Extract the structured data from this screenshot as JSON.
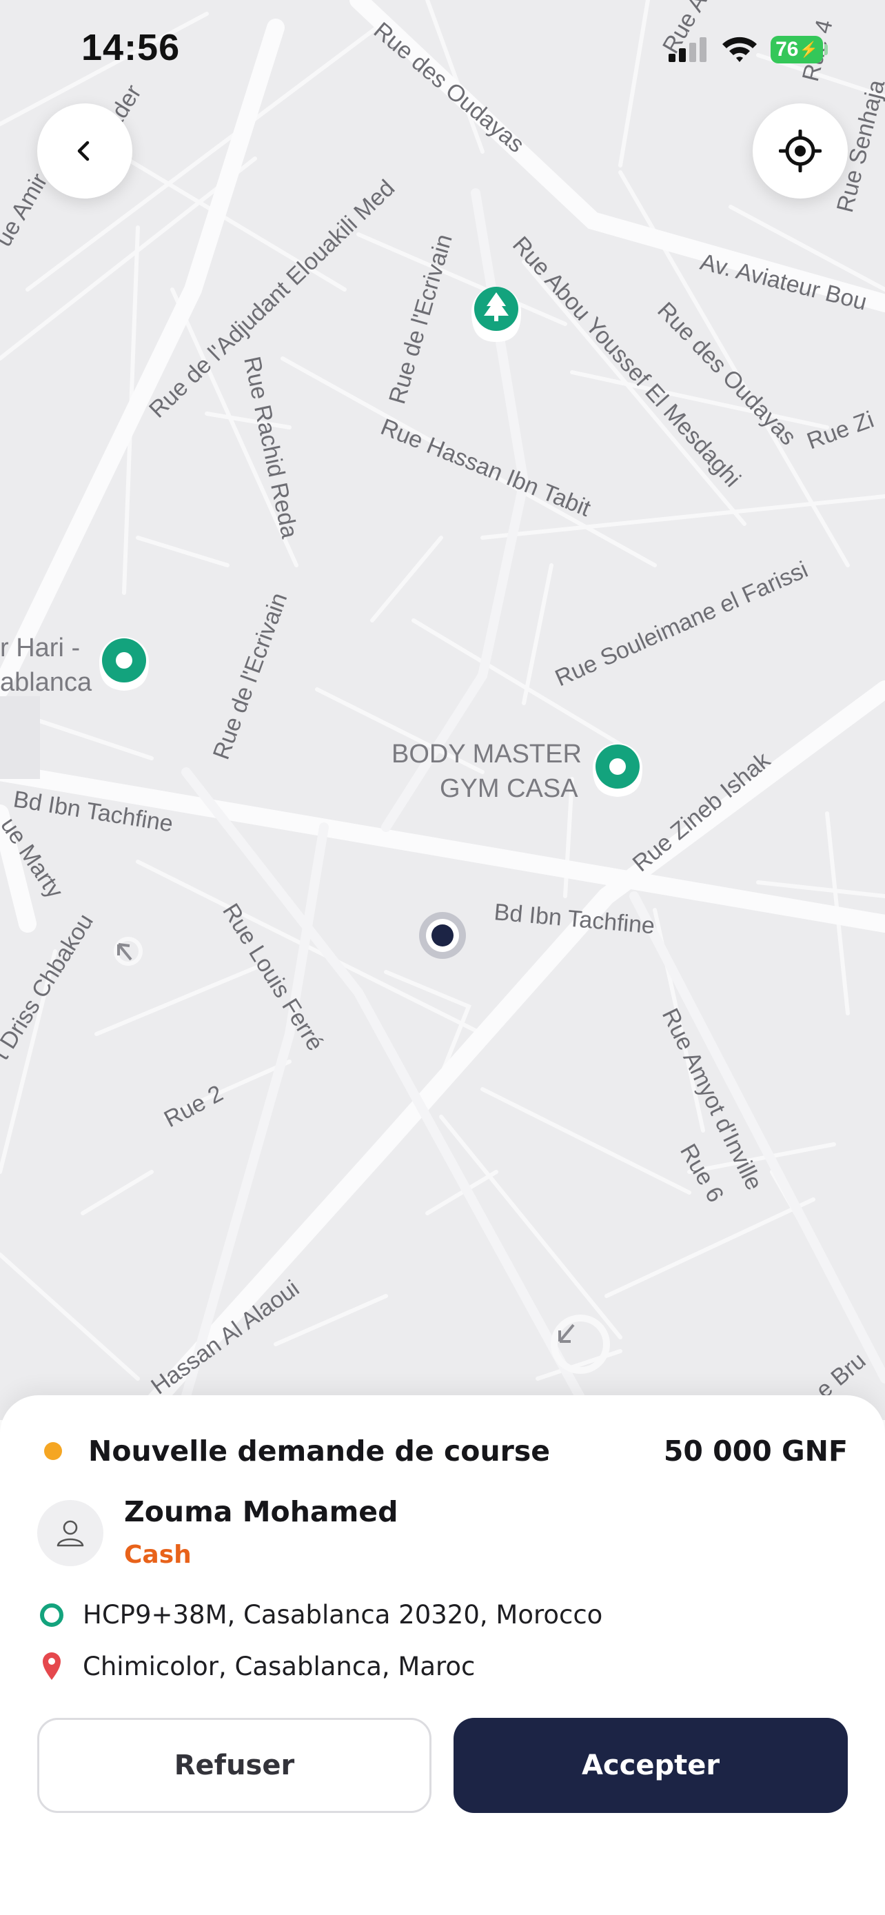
{
  "status_bar": {
    "time": "14:56",
    "battery": "76"
  },
  "map": {
    "streets": [
      "Rue des Oudayas",
      "Av. Aviateur Bou",
      "Rue 4",
      "Rue Senhaja",
      "Rue de l'Adjudant Elouakili Med",
      "Rue de l'Ecrivain",
      "Rue Abou Youssef El Mesdaghi",
      "Rue des Oudayas",
      "Rue Zi",
      "Rue Rachid Reda",
      "Rue Hassan Ibn Tabit",
      "Rue Souleimane el Farissi",
      "Rue de l'Ecrivain",
      "Bd Ibn Tachfine",
      "Rue Zineb Ishak",
      "Bd Ibn Tachfine",
      "ue Marty",
      "t Driss Chbakou",
      "Rue Louis Ferré",
      "Rue 2",
      "Rue Amyot d'Inville",
      "Rue 6",
      "Hassan Al Alaoui",
      "ue Amir",
      "ader",
      "Rue A",
      "e Bru"
    ],
    "pois": [
      {
        "line1": "BODY MASTER",
        "line2": "GYM CASA"
      },
      {
        "line1": "r Hari -",
        "line2": "ablanca"
      }
    ]
  },
  "request": {
    "title": "Nouvelle demande de course",
    "price": "50 000 GNF",
    "rider_name": "Zouma Mohamed",
    "payment_method": "Cash",
    "pickup": "HCP9+38M, Casablanca 20320, Morocco",
    "dropoff": "Chimicolor, Casablanca, Maroc"
  },
  "actions": {
    "refuse": "Refuser",
    "accept": "Accepter"
  },
  "colors": {
    "accent_dark": "#1c2445",
    "payment": "#e8621a",
    "status_dot": "#f5a623",
    "marker_green": "#13a37d",
    "dropoff_red": "#e5484d",
    "battery": "#34c759"
  },
  "icons": [
    "back-chevron-icon",
    "locate-crosshair-icon",
    "user-icon",
    "pickup-ring-icon",
    "dropoff-pin-icon",
    "tree-icon",
    "map-marker-icon"
  ]
}
